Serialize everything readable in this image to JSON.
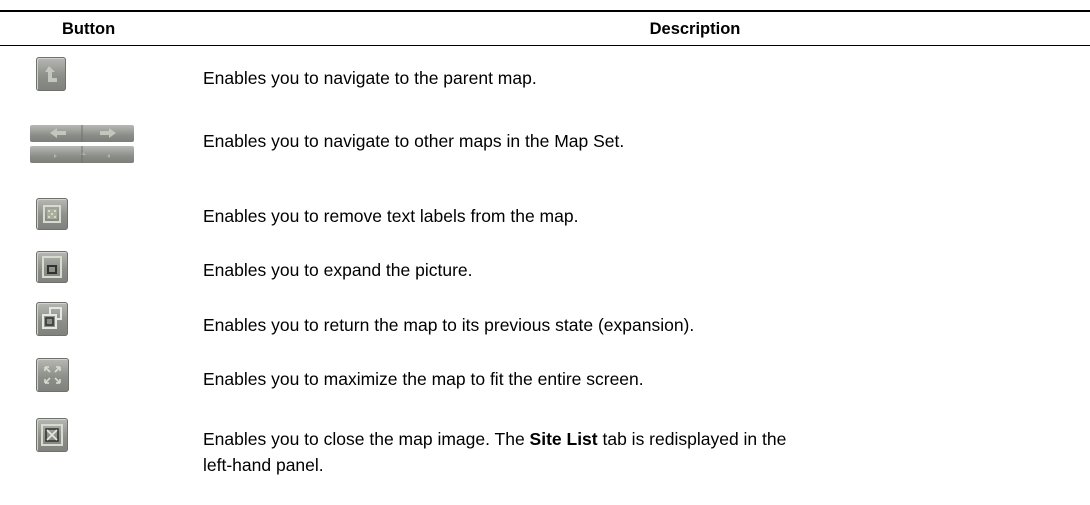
{
  "table": {
    "headers": {
      "button": "Button",
      "description": "Description"
    },
    "rows": [
      {
        "icon": "parent-map-up-arrow-icon",
        "description": "Enables you to navigate to the parent map."
      },
      {
        "icon": "map-set-navigation-arrows-icon",
        "description": "Enables you to navigate to other maps in the Map Set."
      },
      {
        "icon": "remove-labels-icon",
        "description": "Enables you to remove text labels from the map."
      },
      {
        "icon": "expand-picture-icon",
        "description": "Enables you to expand the picture."
      },
      {
        "icon": "restore-previous-state-icon",
        "description": "Enables you to return the map to its previous state (expansion)."
      },
      {
        "icon": "maximize-fullscreen-icon",
        "description": "Enables you to maximize the map to fit the entire screen."
      },
      {
        "icon": "close-map-image-icon",
        "description_before": "Enables you to close the map image. The ",
        "description_bold": "Site List",
        "description_after_line1": " tab is redisplayed in the",
        "description_line2": "left-hand panel."
      }
    ]
  },
  "colors": {
    "icon_face": "#8d8f8a",
    "icon_highlight": "#d2d2cf",
    "icon_glyph": "#d6dccd"
  }
}
